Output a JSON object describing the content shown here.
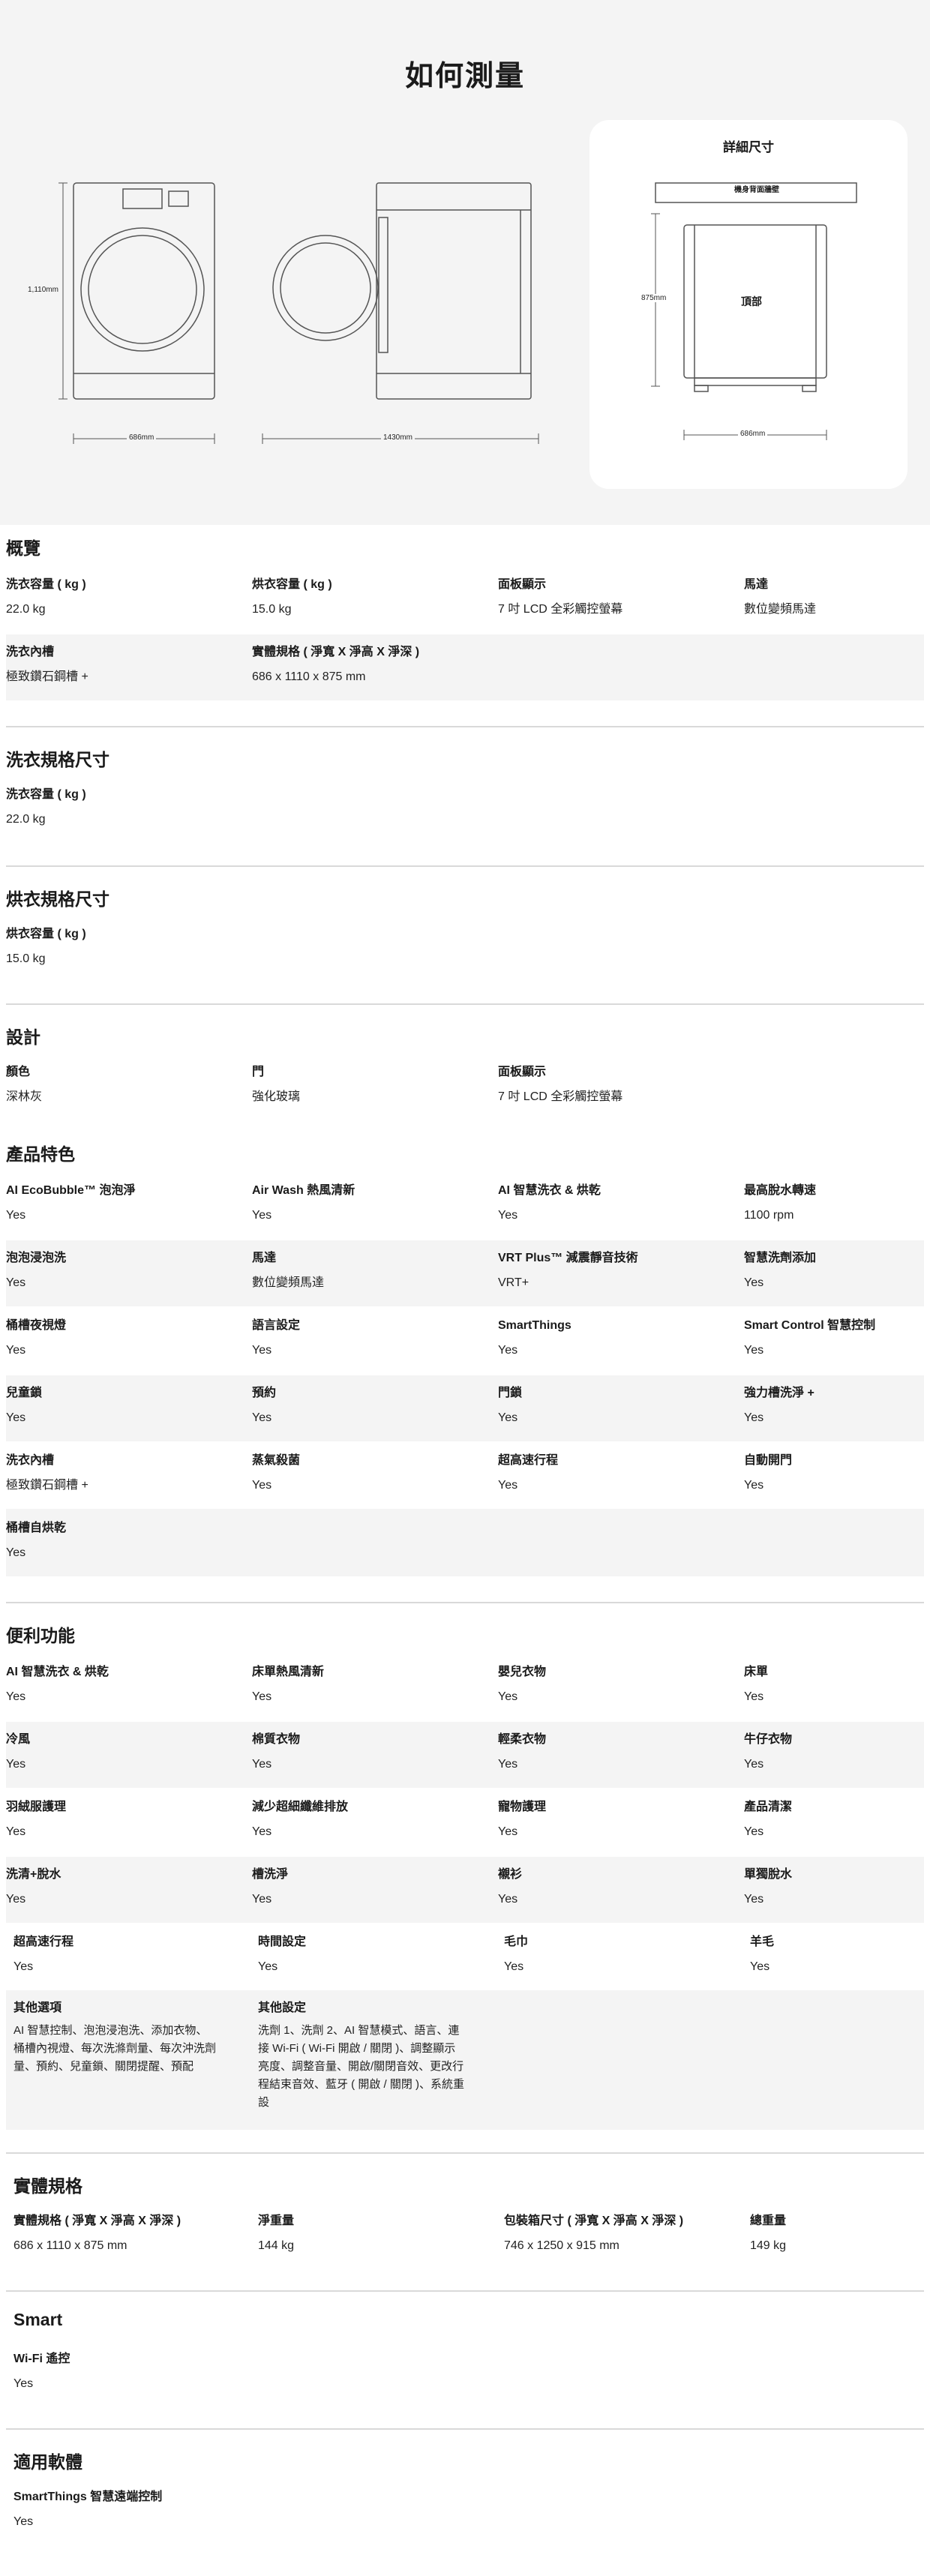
{
  "measure": {
    "title": "如何測量",
    "front_height": "1,110mm",
    "front_width": "686mm",
    "side_depth": "1430mm",
    "detail": {
      "title": "詳細尺寸",
      "back_wall": "機身背面牆壁",
      "top": "頂部",
      "height": "875mm",
      "width": "686mm"
    }
  },
  "overview": {
    "title": "概覽",
    "rows": [
      [
        {
          "label": "洗衣容量 ( kg )",
          "value": "22.0 kg"
        },
        {
          "label": "烘衣容量 ( kg )",
          "value": "15.0 kg"
        },
        {
          "label": "面板顯示",
          "value": "7 吋 LCD 全彩觸控螢幕"
        },
        {
          "label": "馬達",
          "value": "數位變頻馬達"
        }
      ],
      [
        {
          "label": "洗衣內槽",
          "value": "極致鑽石鋼槽 +"
        },
        {
          "label": "實體規格 ( 淨寬 X 淨高 X 淨深 )",
          "value": "686 x 1110 x 875 mm"
        }
      ]
    ]
  },
  "wash_spec": {
    "title": "洗衣規格尺寸",
    "label": "洗衣容量 ( kg )",
    "value": "22.0 kg"
  },
  "dry_spec": {
    "title": "烘衣規格尺寸",
    "label": "烘衣容量 ( kg )",
    "value": "15.0 kg"
  },
  "design": {
    "title": "設計",
    "row": [
      {
        "label": "顏色",
        "value": "深林灰"
      },
      {
        "label": "門",
        "value": "強化玻璃"
      },
      {
        "label": "面板顯示",
        "value": "7 吋 LCD 全彩觸控螢幕"
      }
    ]
  },
  "features": {
    "title": "產品特色",
    "rows": [
      [
        {
          "label": "AI EcoBubble™ 泡泡淨",
          "value": "Yes"
        },
        {
          "label": "Air Wash 熱風清新",
          "value": "Yes"
        },
        {
          "label": "AI 智慧洗衣 & 烘乾",
          "value": "Yes"
        },
        {
          "label": "最高脫水轉速",
          "value": "1100 rpm"
        }
      ],
      [
        {
          "label": "泡泡浸泡洗",
          "value": "Yes"
        },
        {
          "label": "馬達",
          "value": "數位變頻馬達"
        },
        {
          "label": "VRT Plus™ 減震靜音技術",
          "value": "VRT+"
        },
        {
          "label": "智慧洗劑添加",
          "value": "Yes"
        }
      ],
      [
        {
          "label": "桶槽夜視燈",
          "value": "Yes"
        },
        {
          "label": "語言設定",
          "value": "Yes"
        },
        {
          "label": "SmartThings",
          "value": "Yes"
        },
        {
          "label": "Smart Control 智慧控制",
          "value": "Yes"
        }
      ],
      [
        {
          "label": "兒童鎖",
          "value": "Yes"
        },
        {
          "label": "預約",
          "value": "Yes"
        },
        {
          "label": "門鎖",
          "value": "Yes"
        },
        {
          "label": "強力槽洗淨 +",
          "value": "Yes"
        }
      ],
      [
        {
          "label": "洗衣內槽",
          "value": "極致鑽石鋼槽 +"
        },
        {
          "label": "蒸氣殺菌",
          "value": "Yes"
        },
        {
          "label": "超高速行程",
          "value": "Yes"
        },
        {
          "label": "自動開門",
          "value": "Yes"
        }
      ],
      [
        {
          "label": "桶槽自烘乾",
          "value": "Yes"
        }
      ]
    ]
  },
  "convenience": {
    "title": "便利功能",
    "rows": [
      [
        {
          "label": "AI 智慧洗衣 & 烘乾",
          "value": "Yes"
        },
        {
          "label": "床單熱風清新",
          "value": "Yes"
        },
        {
          "label": "嬰兒衣物",
          "value": "Yes"
        },
        {
          "label": "床單",
          "value": "Yes"
        }
      ],
      [
        {
          "label": "冷風",
          "value": "Yes"
        },
        {
          "label": "棉質衣物",
          "value": "Yes"
        },
        {
          "label": "輕柔衣物",
          "value": "Yes"
        },
        {
          "label": "牛仔衣物",
          "value": "Yes"
        }
      ],
      [
        {
          "label": "羽絨服護理",
          "value": "Yes"
        },
        {
          "label": "減少超細纖維排放",
          "value": "Yes"
        },
        {
          "label": "寵物護理",
          "value": "Yes"
        },
        {
          "label": "產品清潔",
          "value": "Yes"
        }
      ],
      [
        {
          "label": "洗清+脫水",
          "value": "Yes"
        },
        {
          "label": "槽洗淨",
          "value": "Yes"
        },
        {
          "label": "襯衫",
          "value": "Yes"
        },
        {
          "label": "單獨脫水",
          "value": "Yes"
        }
      ],
      [
        {
          "label": "超高速行程",
          "value": "Yes"
        },
        {
          "label": "時間設定",
          "value": "Yes"
        },
        {
          "label": "毛巾",
          "value": "Yes"
        },
        {
          "label": "羊毛",
          "value": "Yes"
        }
      ],
      [
        {
          "label": "其他選項",
          "value": "AI 智慧控制、泡泡浸泡洗、添加衣物、桶槽內視燈、每次洗滌劑量、每次沖洗劑量、預約、兒童鎖、關閉提醒、預配"
        },
        {
          "label": "其他設定",
          "value": "洗劑 1、洗劑 2、AI 智慧模式、語言、連接 Wi-Fi ( Wi-Fi 開啟 / 關閉 )、調整顯示亮度、調整音量、開啟/關閉音效、更改行程結束音效、藍牙 ( 開啟 / 關閉 )、系統重設"
        }
      ]
    ]
  },
  "physical": {
    "title": "實體規格",
    "row": [
      {
        "label": "實體規格 ( 淨寬 X 淨高 X 淨深 )",
        "value": "686 x 1110 x 875 mm"
      },
      {
        "label": "淨重量",
        "value": "144 kg"
      },
      {
        "label": "包裝箱尺寸 ( 淨寬 X 淨高 X 淨深 )",
        "value": "746 x 1250 x 915 mm"
      },
      {
        "label": "總重量",
        "value": "149 kg"
      }
    ]
  },
  "smart": {
    "title": "Smart",
    "label": "Wi-Fi 遙控",
    "value": "Yes"
  },
  "software": {
    "title": "適用軟體",
    "label": "SmartThings 智慧遠端控制",
    "value": "Yes"
  }
}
